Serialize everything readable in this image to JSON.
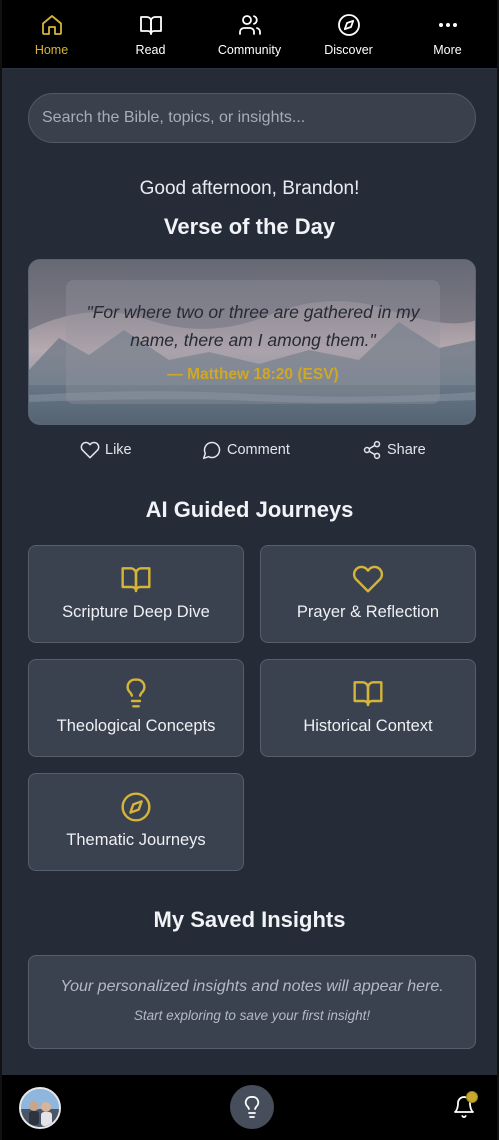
{
  "nav": {
    "items": [
      {
        "label": "Home",
        "icon": "home-icon",
        "active": true
      },
      {
        "label": "Read",
        "icon": "book-open-icon",
        "active": false
      },
      {
        "label": "Community",
        "icon": "users-icon",
        "active": false
      },
      {
        "label": "Discover",
        "icon": "compass-icon",
        "active": false
      },
      {
        "label": "More",
        "icon": "more-dots-icon",
        "active": false
      }
    ]
  },
  "search": {
    "placeholder": "Search the Bible, topics, or insights..."
  },
  "greeting": "Good afternoon, Brandon!",
  "verse_of_day": {
    "title": "Verse of the Day",
    "text": "\"For where two or three are gathered in my name, there am I among them.\"",
    "reference": "— Matthew 18:20 (ESV)"
  },
  "actions": {
    "like": "Like",
    "comment": "Comment",
    "share": "Share"
  },
  "journeys": {
    "title": "AI Guided Journeys",
    "cards": [
      {
        "label": "Scripture Deep Dive",
        "icon": "book-open-icon"
      },
      {
        "label": "Prayer & Reflection",
        "icon": "heart-icon"
      },
      {
        "label": "Theological Concepts",
        "icon": "lightbulb-icon"
      },
      {
        "label": "Historical Context",
        "icon": "book-open-icon"
      },
      {
        "label": "Thematic Journeys",
        "icon": "compass-icon"
      }
    ]
  },
  "saved": {
    "title": "My Saved Insights",
    "empty_main": "Your personalized insights and notes will appear here.",
    "empty_sub": "Start exploring to save your first insight!"
  },
  "colors": {
    "accent": "#d4b53a",
    "background": "#252c38",
    "card": "#3b424f",
    "bar": "#000000"
  }
}
